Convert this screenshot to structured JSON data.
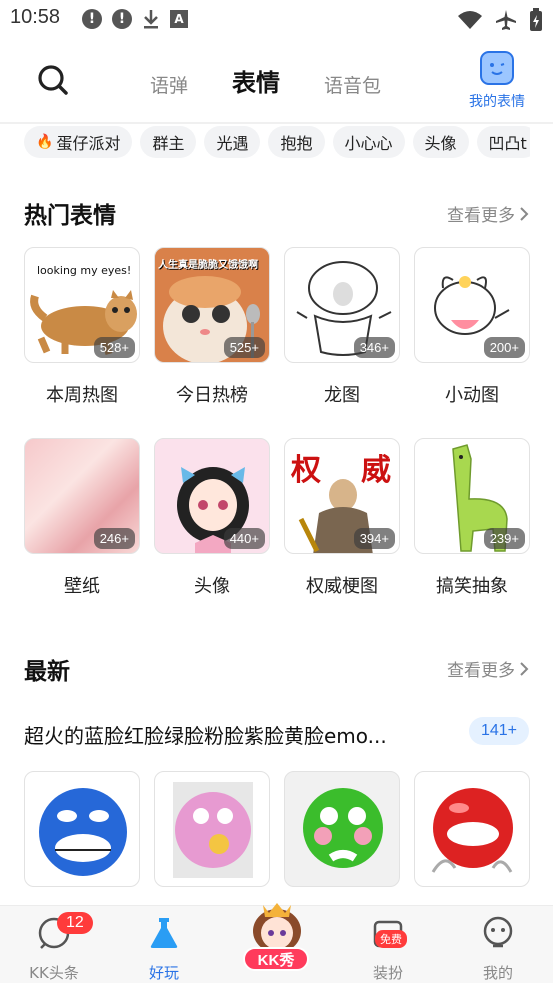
{
  "status_bar": {
    "time": "10:58",
    "notif_a": "!",
    "notif_b": "!",
    "notif_c": "A"
  },
  "header": {
    "tabs": [
      {
        "label": "语弹"
      },
      {
        "label": "表情",
        "active": true
      },
      {
        "label": "语音包"
      }
    ],
    "my_emoji_label": "我的表情"
  },
  "chips": [
    "蛋仔派对",
    "群主",
    "光遇",
    "抱抱",
    "小心心",
    "头像",
    "凹凸t"
  ],
  "hot": {
    "title": "热门表情",
    "see_more": "查看更多",
    "cards": [
      {
        "label": "本周热图",
        "count": "528+",
        "caption": "looking my eyes!"
      },
      {
        "label": "今日热榜",
        "count": "525+",
        "caption": "人生真是脆脆又饿饿啊"
      },
      {
        "label": "龙图",
        "count": "346+"
      },
      {
        "label": "小动图",
        "count": "200+"
      },
      {
        "label": "壁纸",
        "count": "246+"
      },
      {
        "label": "头像",
        "count": "440+"
      },
      {
        "label": "权威梗图",
        "count": "394+",
        "caption_a": "权",
        "caption_b": "威"
      },
      {
        "label": "搞笑抽象",
        "count": "239+"
      }
    ]
  },
  "latest": {
    "title": "最新",
    "see_more": "查看更多",
    "pack_title": "超火的蓝脸红脸绿脸粉脸紫脸黄脸emo...",
    "pack_count": "141+"
  },
  "bottom_nav": {
    "items": [
      {
        "label": "KK头条",
        "badge": "12"
      },
      {
        "label": "好玩",
        "active": true
      },
      {
        "label": "KK秀"
      },
      {
        "label": "装扮",
        "badge": "免费"
      },
      {
        "label": "我的"
      }
    ]
  },
  "colors": {
    "accent": "#2a73e6",
    "highlight": "#ffd429",
    "badge": "#ff3b3b"
  }
}
